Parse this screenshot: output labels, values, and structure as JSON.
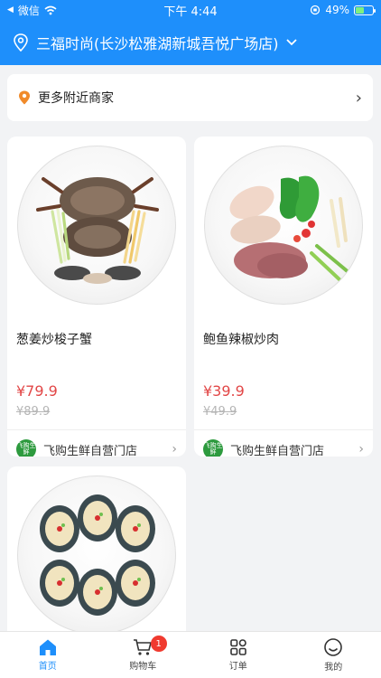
{
  "status_bar": {
    "left_label": "微信",
    "time": "下午 4:44",
    "battery": "49%"
  },
  "store": {
    "name": "三福时尚(长沙松雅湖新城吾悦广场店)"
  },
  "nearby": {
    "label": "更多附近商家"
  },
  "products": [
    {
      "title": "葱姜炒梭子蟹",
      "price": "¥79.9",
      "original_price": "¥89.9",
      "shop_name": "飞购生鲜自营门店",
      "shop_logo_text": "飞购生鲜"
    },
    {
      "title": "鲍鱼辣椒炒肉",
      "price": "¥39.9",
      "original_price": "¥49.9",
      "shop_name": "飞购生鲜自营门店",
      "shop_logo_text": "飞购生鲜"
    },
    {
      "title": "",
      "price": "",
      "original_price": "",
      "shop_name": "",
      "shop_logo_text": ""
    }
  ],
  "tabs": [
    {
      "label": "首页",
      "icon": "home-icon",
      "active": true
    },
    {
      "label": "购物车",
      "icon": "cart-icon",
      "badge": "1"
    },
    {
      "label": "订单",
      "icon": "orders-icon"
    },
    {
      "label": "我的",
      "icon": "profile-icon"
    }
  ],
  "colors": {
    "brand": "#1e8ffb",
    "price": "#e24747",
    "badge": "#f03a2f"
  }
}
